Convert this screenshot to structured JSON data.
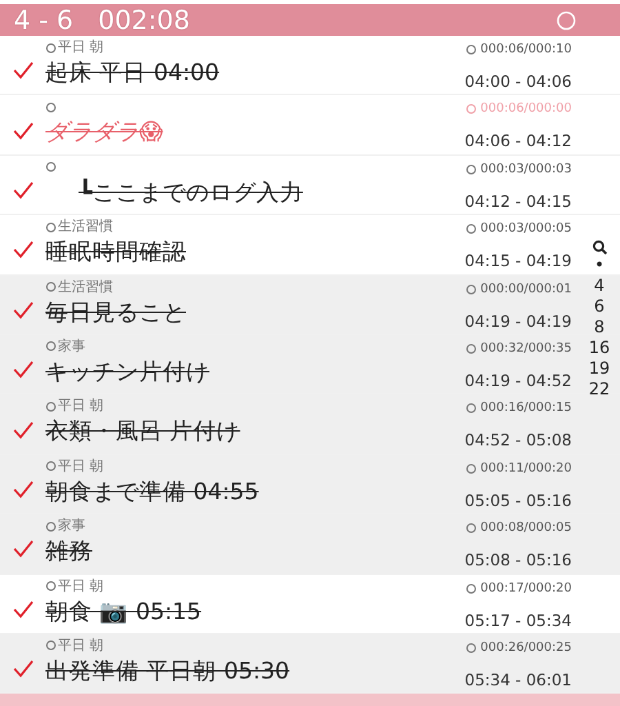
{
  "header": {
    "range": "4 - 6",
    "total": "002:08"
  },
  "rows": [
    {
      "tag": "平日 朝",
      "title": "起床 平日 04:00",
      "kind": "main",
      "checked": true,
      "alert": false,
      "shaded": false,
      "duration": "000:06/000:10",
      "span": "04:00 - 04:06"
    },
    {
      "title": "ダラダラ😱",
      "kind": "main",
      "checked": true,
      "alert": true,
      "shaded": false,
      "duration": "000:06/000:00",
      "span": "04:06 - 04:12"
    },
    {
      "title": "┗ここまでのログ入力",
      "kind": "sub",
      "checked": true,
      "alert": false,
      "shaded": false,
      "duration": "000:03/000:03",
      "span": "04:12 - 04:15"
    },
    {
      "tag": "生活習慣",
      "title": "睡眠時間確認",
      "kind": "main",
      "checked": true,
      "alert": false,
      "shaded": false,
      "duration": "000:03/000:05",
      "span": "04:15 - 04:19"
    },
    {
      "tag": "生活習慣",
      "title": "毎日見ること",
      "kind": "main",
      "checked": true,
      "alert": false,
      "shaded": true,
      "duration": "000:00/000:01",
      "span": "04:19 - 04:19"
    },
    {
      "tag": "家事",
      "title": "キッチン片付け",
      "kind": "main",
      "checked": true,
      "alert": false,
      "shaded": true,
      "duration": "000:32/000:35",
      "span": "04:19 - 04:52"
    },
    {
      "tag": "平日 朝",
      "title": "衣類・風呂 片付け",
      "kind": "main",
      "checked": true,
      "alert": false,
      "shaded": true,
      "duration": "000:16/000:15",
      "span": "04:52 - 05:08"
    },
    {
      "tag": "平日 朝",
      "title": "朝食まで準備 04:55",
      "kind": "main",
      "checked": true,
      "alert": false,
      "shaded": true,
      "duration": "000:11/000:20",
      "span": "05:05 - 05:16"
    },
    {
      "tag": "家事",
      "title": "雑務",
      "kind": "main",
      "checked": true,
      "alert": false,
      "shaded": true,
      "duration": "000:08/000:05",
      "span": "05:08 - 05:16"
    },
    {
      "tag": "平日 朝",
      "title": "朝食 📷 05:15",
      "kind": "main",
      "checked": true,
      "alert": false,
      "shaded": false,
      "duration": "000:17/000:20",
      "span": "05:17 - 05:34"
    },
    {
      "tag": "平日 朝",
      "title": "出発準備 平日朝 05:30",
      "kind": "main",
      "checked": true,
      "alert": false,
      "shaded": true,
      "duration": "000:26/000:25",
      "span": "05:34 - 06:01"
    }
  ],
  "index": [
    "•",
    "4",
    "6",
    "8",
    "16",
    "19",
    "22"
  ]
}
